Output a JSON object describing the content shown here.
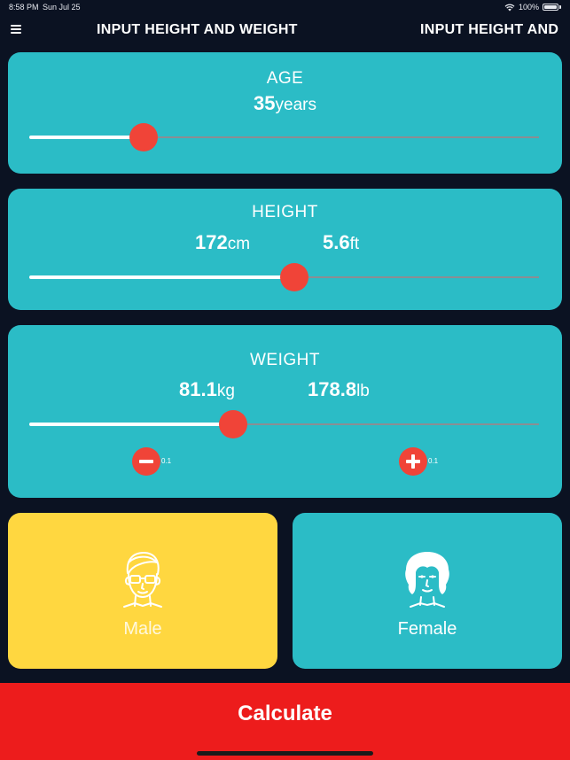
{
  "status_bar": {
    "time": "8:58 PM",
    "date": "Sun Jul 25",
    "battery": "100%"
  },
  "header": {
    "title": "INPUT HEIGHT AND WEIGHT",
    "next_title": "INPUT HEIGHT AND WEIGHT"
  },
  "age": {
    "label": "AGE",
    "value": "35",
    "unit": "years",
    "slider_fraction": 0.225
  },
  "height": {
    "label": "HEIGHT",
    "cm_value": "172",
    "cm_unit": "cm",
    "ft_value": "5.6",
    "ft_unit": "ft",
    "slider_fraction": 0.52
  },
  "weight": {
    "label": "WEIGHT",
    "kg_value": "81.1",
    "kg_unit": "kg",
    "lb_value": "178.8",
    "lb_unit": "lb",
    "slider_fraction": 0.4,
    "decrement_step": "0.1",
    "increment_step": "0.1"
  },
  "gender": {
    "male_label": "Male",
    "female_label": "Female",
    "selected": "Male"
  },
  "calculate_label": "Calculate",
  "colors": {
    "background": "#0b1222",
    "card": "#2bbcc6",
    "selected": "#ffd740",
    "accent": "#f04438",
    "calculate": "#ed1c1c"
  },
  "icons": {
    "menu": "hamburger-icon",
    "wifi": "wifi-icon",
    "battery": "battery-icon",
    "male": "male-face-icon",
    "female": "female-face-icon",
    "minus": "minus-icon",
    "plus": "plus-icon"
  }
}
